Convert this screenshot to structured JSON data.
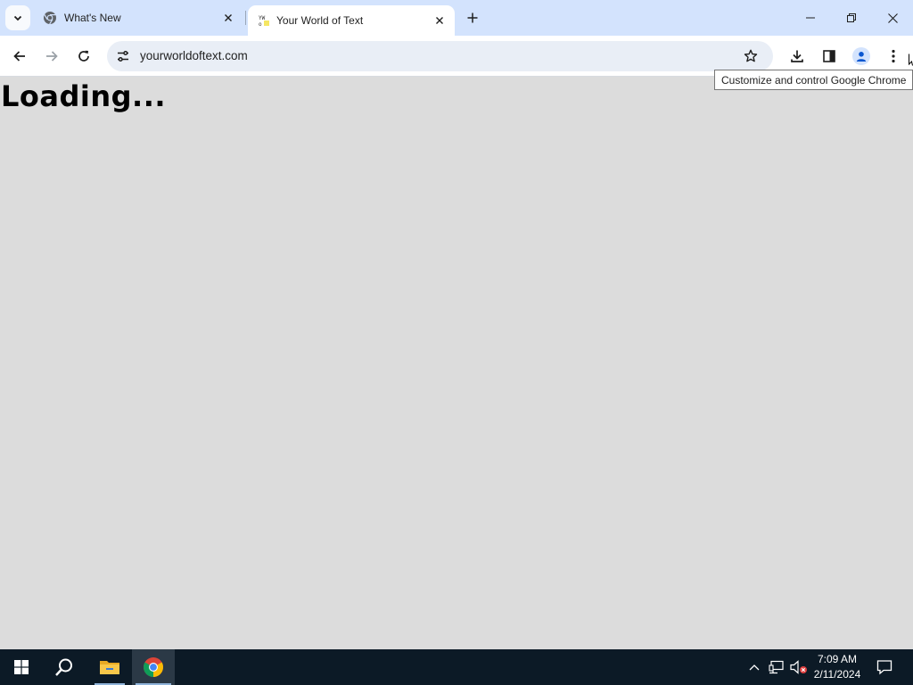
{
  "browser": {
    "tabs": [
      {
        "title": "What's New",
        "active": false,
        "favicon": "chrome-icon"
      },
      {
        "title": "Your World of Text",
        "active": true,
        "favicon": "yourworldoftext-icon"
      }
    ],
    "address_bar": {
      "url": "yourworldoftext.com"
    },
    "tooltip": "Customize and control Google Chrome"
  },
  "page": {
    "loading_text": "Loading..."
  },
  "taskbar": {
    "clock": {
      "time": "7:09 AM",
      "date": "2/11/2024"
    }
  },
  "colors": {
    "tab_strip": "#d3e3fd",
    "toolbar": "#ffffff",
    "omnibox": "#e9eef6",
    "page_background": "#dcdcdc",
    "taskbar": "#0c1a26"
  }
}
